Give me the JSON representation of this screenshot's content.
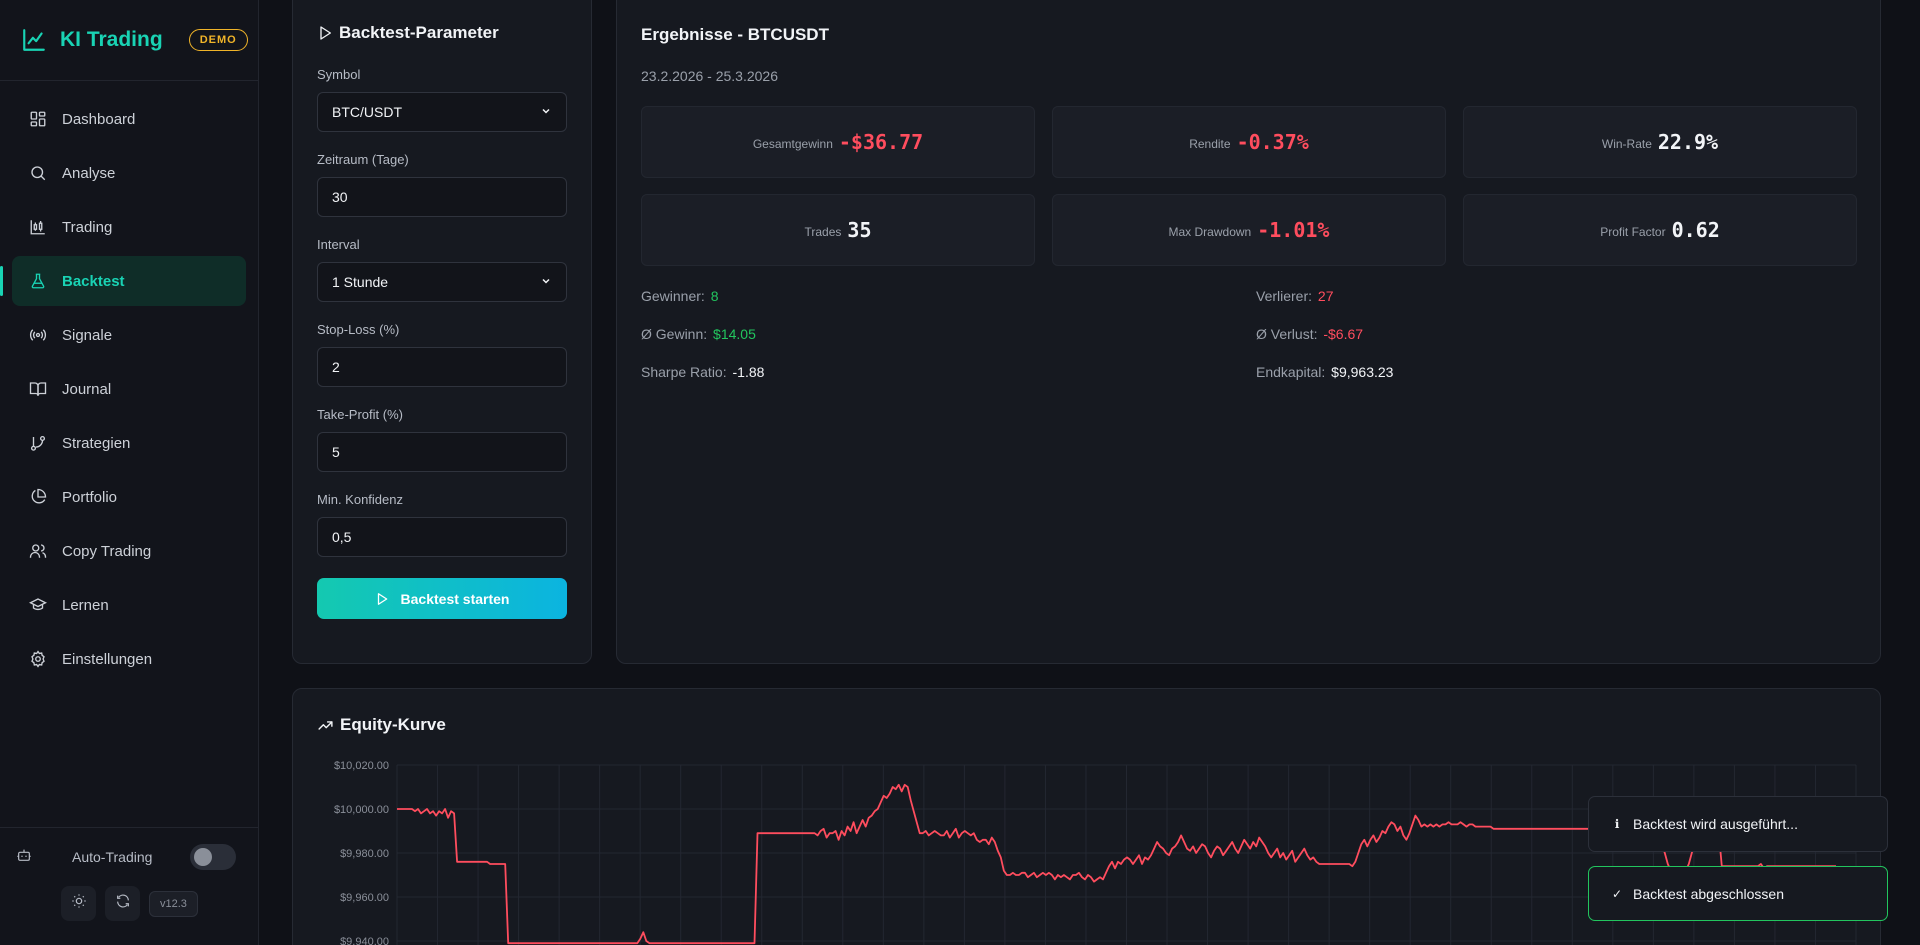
{
  "brand": {
    "name": "KI Trading",
    "badge": "DEMO"
  },
  "nav": [
    {
      "label": "Dashboard",
      "icon": "dashboard-icon",
      "active": false
    },
    {
      "label": "Analyse",
      "icon": "search-icon",
      "active": false
    },
    {
      "label": "Trading",
      "icon": "candlestick-icon",
      "active": false
    },
    {
      "label": "Backtest",
      "icon": "flask-icon",
      "active": true
    },
    {
      "label": "Signale",
      "icon": "broadcast-icon",
      "active": false
    },
    {
      "label": "Journal",
      "icon": "book-icon",
      "active": false
    },
    {
      "label": "Strategien",
      "icon": "git-branch-icon",
      "active": false
    },
    {
      "label": "Portfolio",
      "icon": "pie-chart-icon",
      "active": false
    },
    {
      "label": "Copy Trading",
      "icon": "users-icon",
      "active": false
    },
    {
      "label": "Lernen",
      "icon": "graduation-cap-icon",
      "active": false
    },
    {
      "label": "Einstellungen",
      "icon": "gear-icon",
      "active": false
    }
  ],
  "sidebar_bottom": {
    "auto_trading_label": "Auto-Trading",
    "auto_trading_on": false,
    "version": "v12.3"
  },
  "params": {
    "title": "Backtest-Parameter",
    "symbol_label": "Symbol",
    "symbol_value": "BTC/USDT",
    "period_label": "Zeitraum (Tage)",
    "period_value": "30",
    "interval_label": "Interval",
    "interval_value": "1 Stunde",
    "stoploss_label": "Stop-Loss (%)",
    "stoploss_value": "2",
    "takeprofit_label": "Take-Profit (%)",
    "takeprofit_value": "5",
    "confidence_label": "Min. Konfidenz",
    "confidence_value": "0,5",
    "start_button": "Backtest starten"
  },
  "results": {
    "title": "Ergebnisse - BTCUSDT",
    "date_range": "23.2.2026 - 25.3.2026",
    "stats": [
      {
        "label": "Gesamtgewinn",
        "value": "-$36.77",
        "tone": "neg"
      },
      {
        "label": "Rendite",
        "value": "-0.37%",
        "tone": "neg"
      },
      {
        "label": "Win-Rate",
        "value": "22.9%",
        "tone": "white"
      },
      {
        "label": "Trades",
        "value": "35",
        "tone": "white"
      },
      {
        "label": "Max Drawdown",
        "value": "-1.01%",
        "tone": "neg"
      },
      {
        "label": "Profit Factor",
        "value": "0.62",
        "tone": "white"
      }
    ],
    "details": {
      "winners_label": "Gewinner:",
      "winners_value": "8",
      "losers_label": "Verlierer:",
      "losers_value": "27",
      "avg_win_label": "Ø Gewinn:",
      "avg_win_value": "$14.05",
      "avg_loss_label": "Ø Verlust:",
      "avg_loss_value": "-$6.67",
      "sharpe_label": "Sharpe Ratio:",
      "sharpe_value": "-1.88",
      "end_capital_label": "Endkapital:",
      "end_capital_value": "$9,963.23"
    }
  },
  "equity": {
    "title": "Equity-Kurve"
  },
  "chart_data": {
    "type": "line",
    "title": "Equity-Kurve",
    "xlabel": "",
    "ylabel": "",
    "y_tick_labels": [
      "$10,020.00",
      "$10,000.00",
      "$9,980.00",
      "$9,960.00",
      "$9,940.00"
    ],
    "y_ticks": [
      10020,
      10000,
      9980,
      9960,
      9940
    ],
    "ylim": [
      9940,
      10020
    ],
    "grid": true,
    "line_color": "#ff4d5e",
    "series": [
      {
        "values": [
          10000,
          10000,
          10000,
          10000,
          10000,
          10000,
          9999,
          10000,
          9998,
          9999,
          10000,
          9998,
          9999,
          9997,
          9999,
          9998,
          10000,
          9996,
          9999,
          9998,
          9976,
          9976,
          9976,
          9976,
          9976,
          9976,
          9976,
          9976,
          9976,
          9976,
          9976,
          9975,
          9975,
          9975,
          9975,
          9975,
          9975,
          9939,
          9939,
          9939,
          9939,
          9939,
          9939,
          9939,
          9939,
          9939,
          9939,
          9939,
          9939,
          9939,
          9939,
          9939,
          9939,
          9939,
          9939,
          9939,
          9939,
          9939,
          9939,
          9939,
          9939,
          9939,
          9939,
          9939,
          9939,
          9939,
          9939,
          9939,
          9939,
          9939,
          9939,
          9939,
          9939,
          9939,
          9939,
          9939,
          9939,
          9939,
          9939,
          9939,
          9939,
          9941,
          9944,
          9940,
          9939,
          9939,
          9939,
          9939,
          9939,
          9939,
          9939,
          9939,
          9939,
          9939,
          9939,
          9939,
          9939,
          9939,
          9939,
          9939,
          9939,
          9939,
          9939,
          9939,
          9939,
          9939,
          9939,
          9939,
          9939,
          9939,
          9939,
          9939,
          9939,
          9939,
          9939,
          9939,
          9939,
          9939,
          9939,
          9939,
          9989,
          9989,
          9989,
          9989,
          9989,
          9989,
          9989,
          9989,
          9989,
          9989,
          9989,
          9989,
          9989,
          9989,
          9989,
          9989,
          9989,
          9989,
          9989,
          9989,
          9988,
          9990,
          9991,
          9987,
          9989,
          9989,
          9990,
          9986,
          9990,
          9988,
          9992,
          9990,
          9994,
          9989,
          9992,
          9995,
          9992,
          9996,
          9997,
          9999,
          10000,
          10003,
          10006,
          10005,
          10007,
          10010,
          10009,
          10011,
          10008,
          10011,
          10010,
          10004,
          9999,
          9994,
          9989,
          9989,
          9990,
          9988,
          9989,
          9990,
          9989,
          9988,
          9988,
          9990,
          9987,
          9989,
          9991,
          9987,
          9989,
          9990,
          9989,
          9988,
          9989,
          9986,
          9985,
          9986,
          9986,
          9984,
          9987,
          9985,
          9981,
          9978,
          9972,
          9970,
          9970,
          9971,
          9970,
          9970,
          9971,
          9971,
          9969,
          9970,
          9971,
          9969,
          9970,
          9971,
          9970,
          9971,
          9970,
          9968,
          9970,
          9969,
          9970,
          9969,
          9968,
          9970,
          9970,
          9971,
          9969,
          9968,
          9970,
          9969,
          9967,
          9968,
          9969,
          9968,
          9971,
          9974,
          9976,
          9973,
          9976,
          9975,
          9977,
          9978,
          9977,
          9975,
          9977,
          9979,
          9975,
          9978,
          9977,
          9979,
          9982,
          9985,
          9983,
          9982,
          9980,
          9979,
          9982,
          9983,
          9985,
          9988,
          9985,
          9982,
          9981,
          9983,
          9980,
          9982,
          9984,
          9983,
          9980,
          9978,
          9981,
          9983,
          9982,
          9979,
          9981,
          9983,
          9985,
          9982,
          9980,
          9983,
          9986,
          9984,
          9982,
          9985,
          9983,
          9987,
          9985,
          9983,
          9980,
          9978,
          9980,
          9982,
          9978,
          9980,
          9977,
          9979,
          9981,
          9976,
          9978,
          9980,
          9982,
          9979,
          9977,
          9978,
          9976,
          9975,
          9975,
          9975,
          9975,
          9975,
          9975,
          9975,
          9975,
          9975,
          9975,
          9975,
          9974,
          9976,
          9980,
          9984,
          9986,
          9983,
          9986,
          9988,
          9985,
          9987,
          9990,
          9989,
          9992,
          9994,
          9993,
          9990,
          9992,
          9988,
          9986,
          9989,
          9993,
          9997,
          9995,
          9992,
          9993,
          9992,
          9993,
          9992,
          9993,
          9992,
          9993,
          9993,
          9994,
          9993,
          9993,
          9993,
          9994,
          9993,
          9992,
          9993,
          9993,
          9992,
          9992,
          9992,
          9992,
          9992,
          9992,
          9991,
          9991,
          9991,
          9991,
          9991,
          9991,
          9991,
          9991,
          9991,
          9991,
          9991,
          9991,
          9991,
          9991,
          9991,
          9991,
          9991,
          9991,
          9991,
          9991,
          9991,
          9991,
          9991,
          9991,
          9991,
          9991,
          9991,
          9991,
          9991,
          9991,
          9991,
          9991,
          9991,
          9991,
          9991,
          9990,
          9988,
          9988,
          9988,
          9988,
          9988,
          9988,
          9988,
          9988,
          9988,
          9988,
          9988,
          9988,
          9988,
          9988,
          9988,
          9988,
          9988,
          9988,
          9988,
          9987,
          9984,
          9980,
          9975,
          9972,
          9970,
          9969,
          9971,
          9973,
          9972,
          9975,
          9980,
          9985,
          9988,
          9989,
          9990,
          9989,
          9989,
          9990,
          9989,
          9989,
          9974,
          9974,
          9974,
          9974,
          9974,
          9974,
          9974,
          9974,
          9974,
          9974,
          9974,
          9974,
          9974,
          9975,
          9973,
          9974,
          9974,
          9974,
          9974,
          9974,
          9974,
          9974,
          9974,
          9974,
          9974,
          9974,
          9974,
          9974,
          9974,
          9974,
          9974,
          9974,
          9974,
          9974,
          9974,
          9974,
          9974,
          9974,
          9974
        ]
      }
    ]
  },
  "toasts": [
    {
      "icon": "info-icon",
      "text": "Backtest wird ausgeführt..."
    },
    {
      "icon": "check-icon",
      "text": "Backtest abgeschlossen"
    }
  ],
  "colors": {
    "accent": "#19d3b4",
    "negative": "#ff4d5e",
    "positive": "#22c55e",
    "demo": "#f0b429"
  }
}
